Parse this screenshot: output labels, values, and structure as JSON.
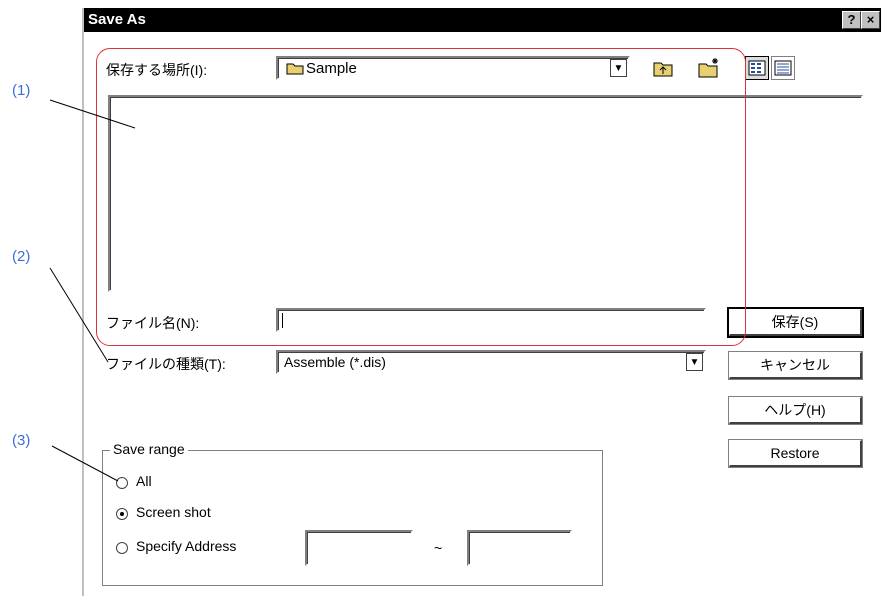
{
  "title": "Save As",
  "title_buttons": {
    "help": "?",
    "close": "×"
  },
  "location": {
    "label": "保存する場所(I):",
    "value": "Sample"
  },
  "filename": {
    "label": "ファイル名(N):",
    "value": ""
  },
  "filetype": {
    "label": "ファイルの種類(T):",
    "value": "Assemble (*.dis)"
  },
  "buttons": {
    "save": "保存(S)",
    "cancel": "キャンセル",
    "help": "ヘルプ(H)",
    "restore": "Restore"
  },
  "save_range": {
    "legend": "Save range",
    "options": [
      "All",
      "Screen shot",
      "Specify Address"
    ],
    "selected": "Screen shot",
    "address_from": "",
    "address_to": "",
    "separator": "~"
  },
  "annotations": [
    "(1)",
    "(2)",
    "(3)"
  ],
  "colors": {
    "annotation": "#3b6fd8",
    "highlight": "#e0303a"
  }
}
